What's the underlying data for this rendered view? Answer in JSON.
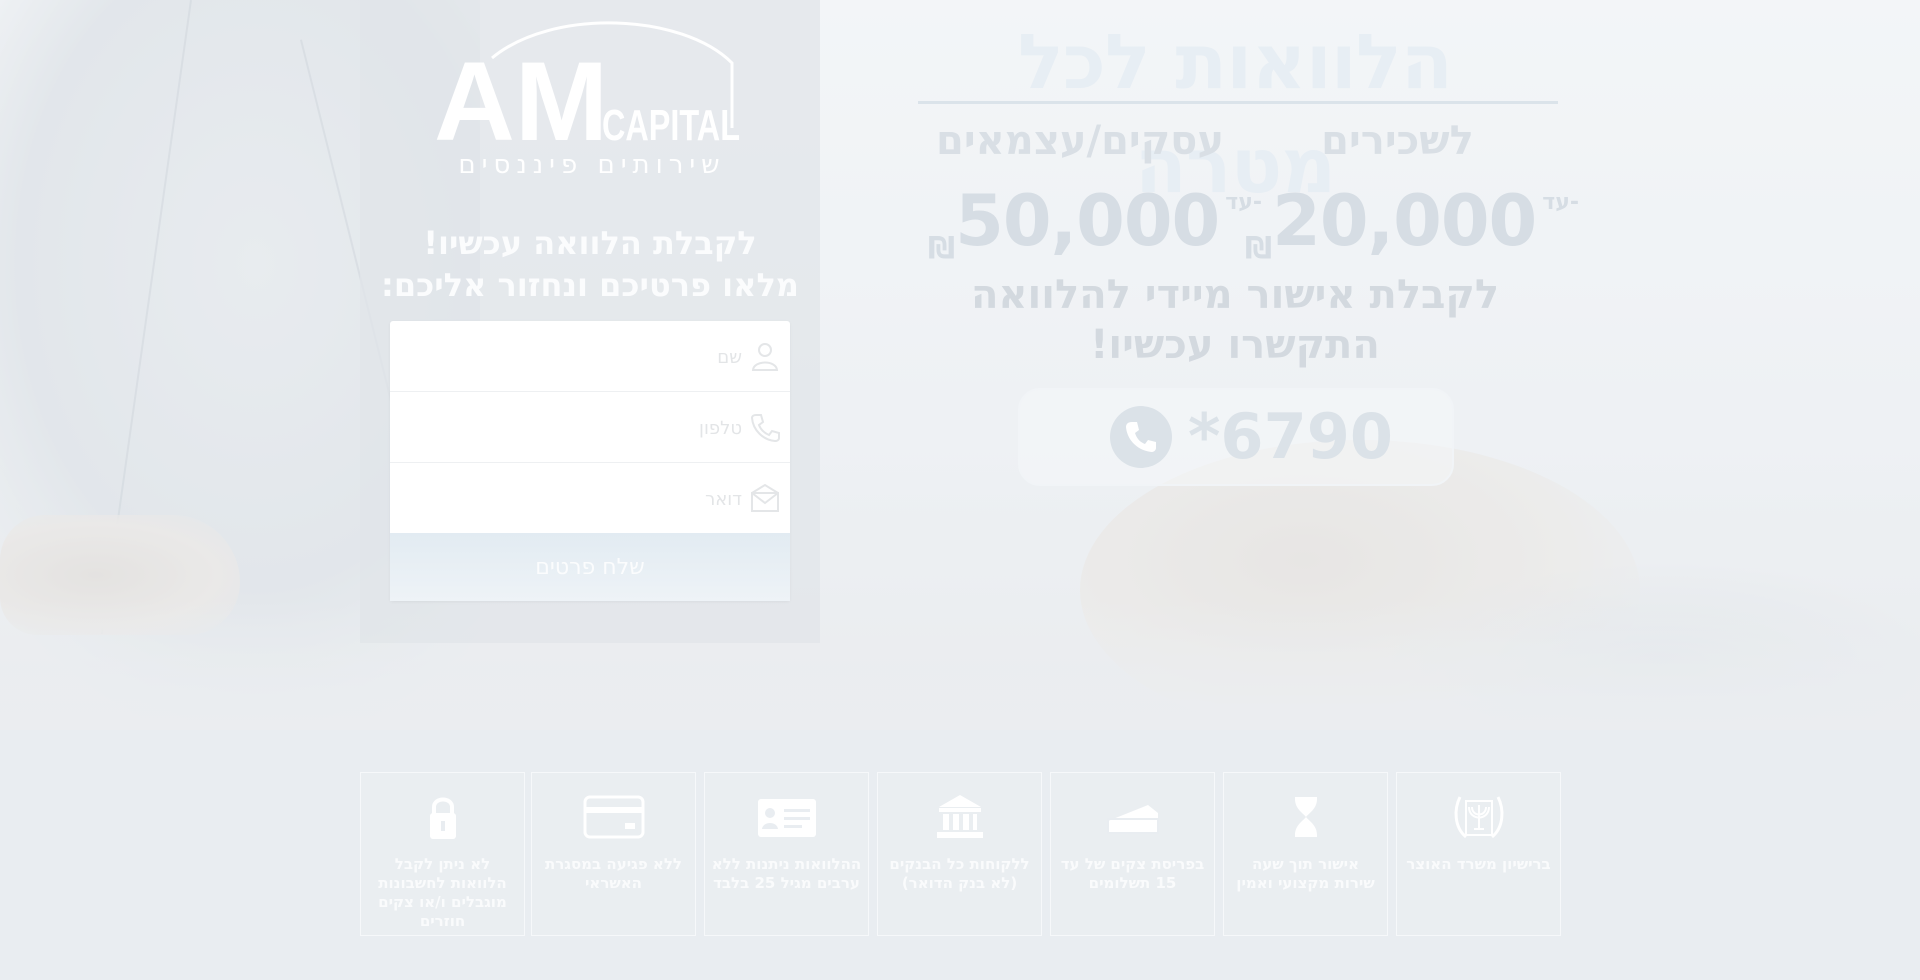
{
  "logo": {
    "letters": "AM",
    "capital": "CAPITAL",
    "tagline": "שירותים פיננסים"
  },
  "form": {
    "heading_line1": "לקבלת הלוואה עכשיו!",
    "heading_line2": "מלאו פרטיכם ונחזור אליכם:",
    "fields": [
      {
        "placeholder": "שם",
        "icon": "user-icon"
      },
      {
        "placeholder": "טלפון",
        "icon": "phone-icon"
      },
      {
        "placeholder": "דואר",
        "icon": "envelope-icon"
      }
    ],
    "submit_label": "שלח פרטים"
  },
  "hero": {
    "title": "הלוואות לכל מטרה",
    "categories": [
      {
        "label": "לשכירים",
        "upto": "עד-",
        "amount": "20,000",
        "currency": "₪"
      },
      {
        "label": "עסקים/עצמאים",
        "upto": "עד-",
        "amount": "50,000",
        "currency": "₪"
      }
    ],
    "sub_line1": "לקבלת אישור מיידי להלוואה",
    "sub_line2": "התקשרו עכשיו!",
    "phone": "*6790"
  },
  "features": [
    {
      "icon": "state-emblem-icon",
      "text": "ברישיון משרד האוצר"
    },
    {
      "icon": "hourglass-icon",
      "text": "אישור תוך שעה שירות מקצועי ואמין"
    },
    {
      "icon": "banknote-icon",
      "text": "בפריסת צקים של עד 15 תשלומים"
    },
    {
      "icon": "bank-icon",
      "text": "ללקוחות כל הבנקים (לא בנק הדואר)"
    },
    {
      "icon": "id-card-icon",
      "text": "ההלוואות ניתנות ללא ערבים מגיל 25 בלבד"
    },
    {
      "icon": "credit-card-icon",
      "text": "ללא פגיעה במסגרת האשראי"
    },
    {
      "icon": "lock-icon",
      "text": "לא ניתן לקבל הלוואות לחשבונות מוגבלים ו/או צקים חוזרים"
    }
  ]
}
